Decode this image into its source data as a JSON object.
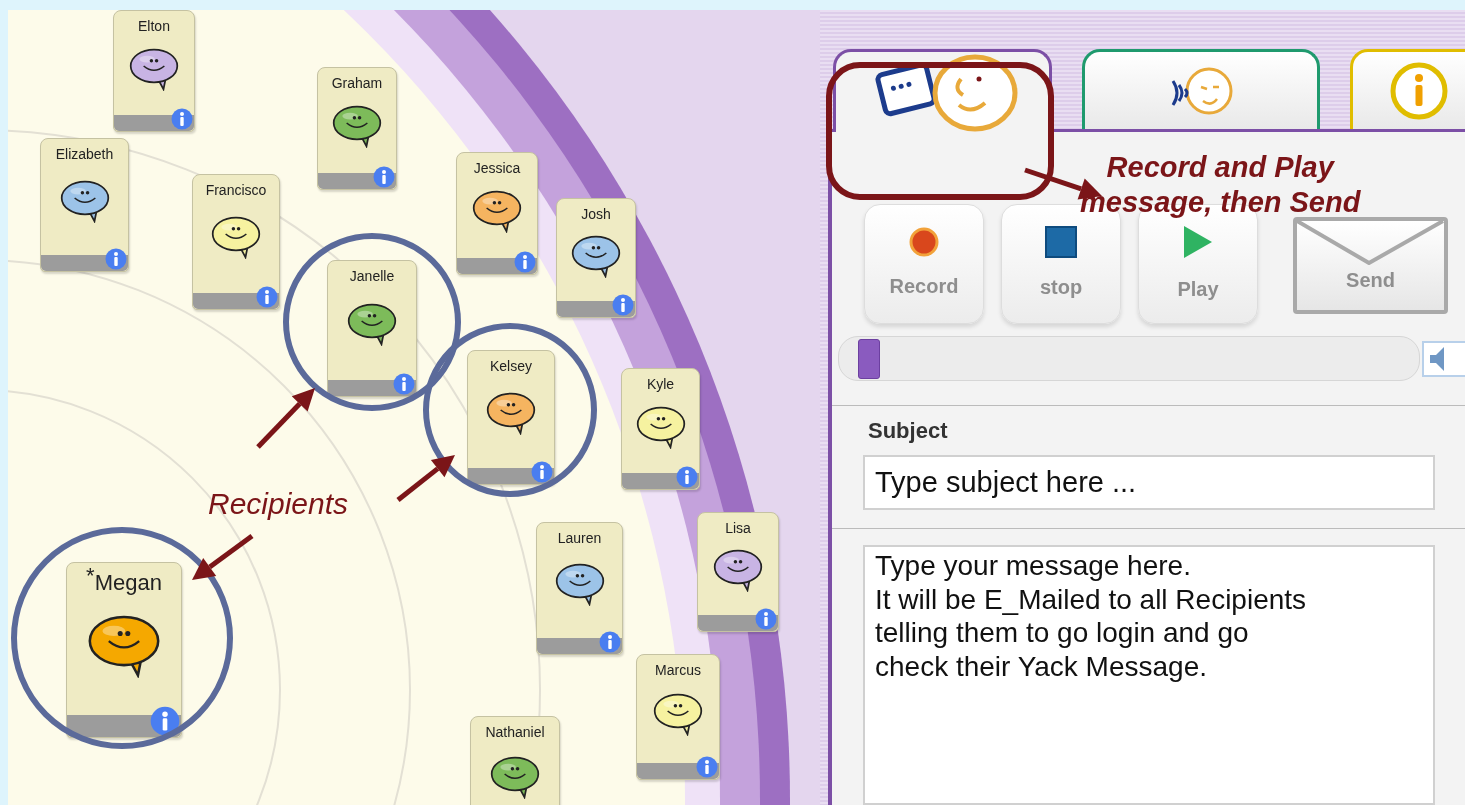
{
  "contacts": [
    {
      "name": "Elton",
      "color": "#c8b4e4",
      "selected": false
    },
    {
      "name": "Graham",
      "color": "#7dbb5a",
      "selected": false
    },
    {
      "name": "Elizabeth",
      "color": "#9cc3e8",
      "selected": false
    },
    {
      "name": "Francisco",
      "color": "#f6f2a0",
      "selected": false
    },
    {
      "name": "Jessica",
      "color": "#f5b460",
      "selected": false
    },
    {
      "name": "Josh",
      "color": "#9cc3e8",
      "selected": false
    },
    {
      "name": "Janelle",
      "color": "#7dbb5a",
      "selected": true
    },
    {
      "name": "Kelsey",
      "color": "#f5b460",
      "selected": true
    },
    {
      "name": "Kyle",
      "color": "#f6f2a0",
      "selected": false
    },
    {
      "name": "Lauren",
      "color": "#9cc3e8",
      "selected": false
    },
    {
      "name": "Lisa",
      "color": "#c8b4e4",
      "selected": false
    },
    {
      "name": "$^{*}$Megan",
      "color": "#f5a800",
      "selected": true
    },
    {
      "name": "Marcus",
      "color": "#f6f2a0",
      "selected": false
    },
    {
      "name": "Nathaniel",
      "color": "#7dbb5a",
      "selected": false
    }
  ],
  "annotations": {
    "recipients_label": "Recipients",
    "instruction": [
      "Record and Play",
      "message, then Send"
    ]
  },
  "panel": {
    "tabs": [
      {
        "kind": "message",
        "selected": true
      },
      {
        "kind": "listen",
        "selected": false
      },
      {
        "kind": "info",
        "selected": false
      }
    ],
    "buttons": [
      {
        "kind": "record",
        "label": "Record"
      },
      {
        "kind": "stop",
        "label": "stop"
      },
      {
        "kind": "play",
        "label": "Play"
      },
      {
        "kind": "send",
        "label": "Send"
      }
    ],
    "progress": {
      "level": 0.02
    },
    "subject": {
      "label": "Subject",
      "value": "Type subject here ..."
    },
    "message": {
      "value": "Type your message here.\nIt will be E_Mailed to all Recipients\ntelling them to go login and go\ncheck their Yack Message."
    }
  }
}
